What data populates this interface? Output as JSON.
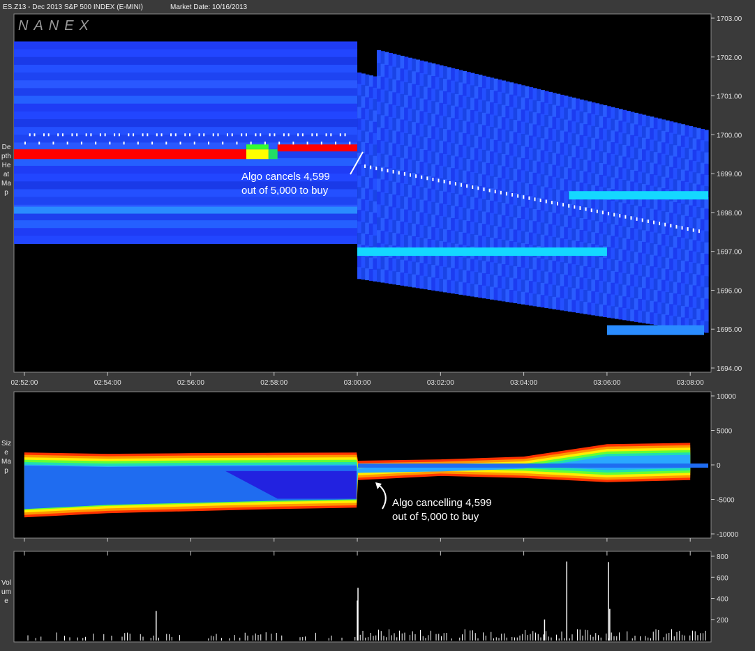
{
  "title": {
    "symbol": "ES.Z13 - Dec 2013 S&P 500 INDEX (E-MINI)",
    "market_date": "Market Date: 10/16/2013"
  },
  "logo": "NANEX",
  "panels": {
    "depth": {
      "label": "Depth Heat Map"
    },
    "size": {
      "label": "Size Map"
    },
    "volume": {
      "label": "Volume"
    }
  },
  "colors": {
    "background": "#000000",
    "frame": "#3a3a3a",
    "depth_blue": "#1a3cff",
    "depth_light": "#2a8cff",
    "cyan": "#14d8ff",
    "red": "#ff0000",
    "green": "#33ff33",
    "yellow": "#ffff00"
  },
  "chart_data": [
    {
      "type": "heatmap",
      "panel": "depth",
      "x_ticks": [
        "02:52:00",
        "02:54:00",
        "02:56:00",
        "02:58:00",
        "03:00:00",
        "03:02:00",
        "03:04:00",
        "03:06:00",
        "03:08:00"
      ],
      "y_ticks": [
        "1703.00",
        "1702.00",
        "1701.00",
        "1700.00",
        "1699.00",
        "1698.00",
        "1697.00",
        "1696.00",
        "1695.00",
        "1694.00"
      ],
      "ylim": [
        1694,
        1703
      ],
      "annotations": [
        {
          "lines": [
            "Algo cancels 4,599",
            "out of 5,000 to buy"
          ]
        }
      ],
      "features": {
        "pre_break_book": {
          "x_range": [
            "02:52:00",
            "03:00:00"
          ],
          "price_range": [
            1697.2,
            1702.4
          ]
        },
        "large_bid": {
          "x_range": [
            "02:52:00",
            "03:00:00"
          ],
          "price": 1699.5,
          "size": 5000
        },
        "post_break_book": {
          "x_range": [
            "03:00:00",
            "03:08:00"
          ],
          "price_range": [
            1694.8,
            1702.3
          ]
        }
      }
    },
    {
      "type": "heatmap",
      "panel": "size",
      "y_ticks": [
        "10000",
        "5000",
        "0",
        "-5000",
        "-10000"
      ],
      "ylim": [
        -10000,
        10000
      ],
      "annotations": [
        {
          "lines": [
            "Algo cancelling 4,599",
            "out of 5,000 to buy"
          ]
        }
      ],
      "series": [
        {
          "x": [
            "02:52:00",
            "02:54:00",
            "02:56:00",
            "02:58:00",
            "02:59:59",
            "03:00:01",
            "03:02:00",
            "03:04:00",
            "03:06:00",
            "03:08:00"
          ],
          "upper": [
            1800,
            1600,
            1700,
            1750,
            1800,
            600,
            800,
            1200,
            3000,
            3200
          ],
          "lower": [
            -7600,
            -7000,
            -6700,
            -6400,
            -6200,
            -2200,
            -1600,
            -1900,
            -2500,
            -2200
          ]
        }
      ]
    },
    {
      "type": "bar",
      "panel": "volume",
      "y_ticks": [
        "800",
        "600",
        "400",
        "200"
      ],
      "ylim": [
        0,
        820
      ],
      "spikes": [
        {
          "x": "02:55:10",
          "value": 280
        },
        {
          "x": "03:00:01",
          "value": 500
        },
        {
          "x": "03:00:00",
          "value": 380
        },
        {
          "x": "03:05:02",
          "value": 750
        },
        {
          "x": "03:06:02",
          "value": 745
        },
        {
          "x": "03:06:04",
          "value": 300
        },
        {
          "x": "03:04:30",
          "value": 200
        }
      ]
    }
  ]
}
